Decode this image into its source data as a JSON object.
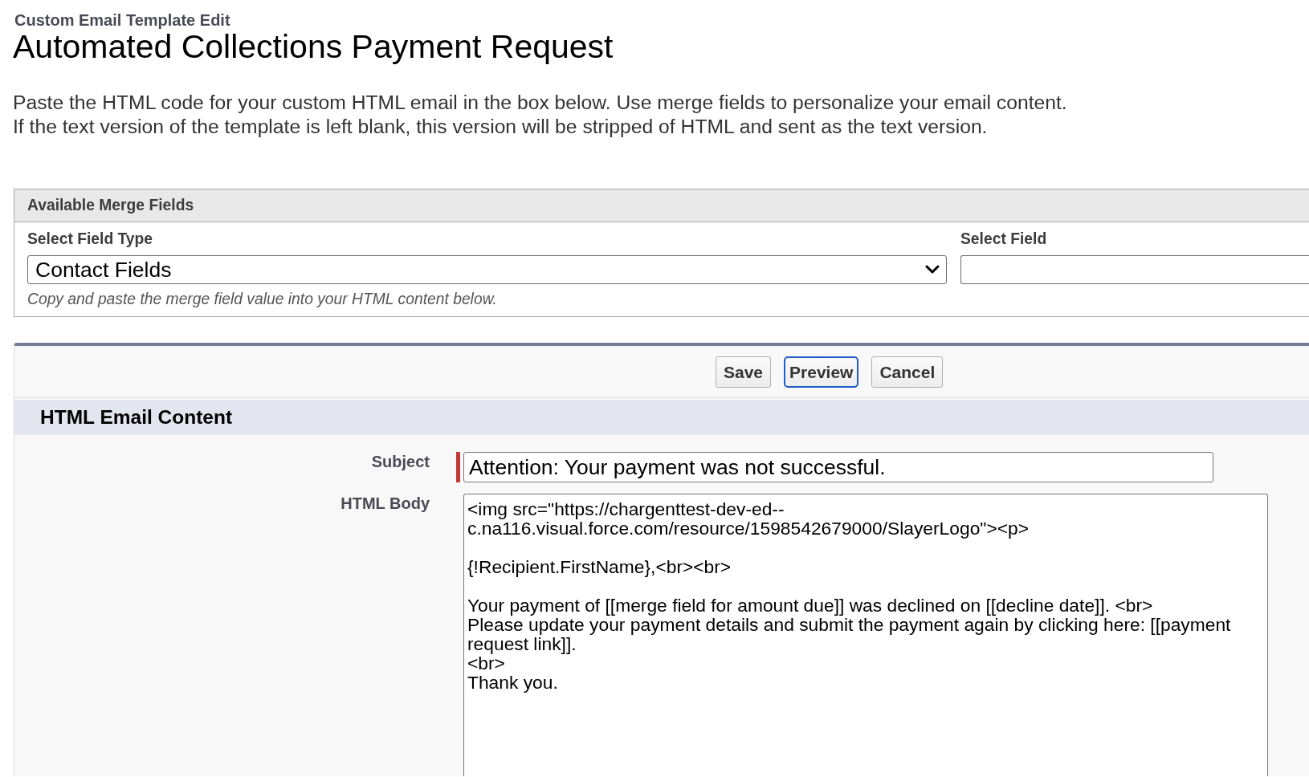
{
  "header": {
    "breadcrumb": "Custom Email Template Edit",
    "title": "Automated Collections Payment Request"
  },
  "instructions": [
    "Paste the HTML code for your custom HTML email in the box below. Use merge fields to personalize your email content.",
    "If the text version of the template is left blank, this version will be stripped of HTML and sent as the text version."
  ],
  "merge_fields": {
    "title": "Available Merge Fields",
    "field_type": {
      "label": "Select Field Type",
      "value": "Contact Fields"
    },
    "field": {
      "label": "Select Field"
    },
    "hint": "Copy and paste the merge field value into your HTML content below."
  },
  "editor": {
    "buttons": [
      {
        "label": "Save",
        "focused": false
      },
      {
        "label": "Preview",
        "focused": true
      },
      {
        "label": "Cancel",
        "focused": false
      }
    ],
    "section_title": "HTML Email Content",
    "fields": [
      {
        "kind": "input",
        "label": "Subject",
        "required": true,
        "value": "Attention: Your payment was not successful."
      },
      {
        "kind": "textarea",
        "label": "HTML Body",
        "required": false,
        "value": "<img src=\"https://chargenttest-dev-ed--c.na116.visual.force.com/resource/1598542679000/SlayerLogo\"><p>\n\n{!Recipient.FirstName},<br><br>\n\nYour payment of [[merge field for amount due]] was declined on [[decline date]]. <br>\nPlease update your payment details and submit the payment again by clicking here: [[payment request link]].\n<br>\nThank you."
      }
    ]
  }
}
